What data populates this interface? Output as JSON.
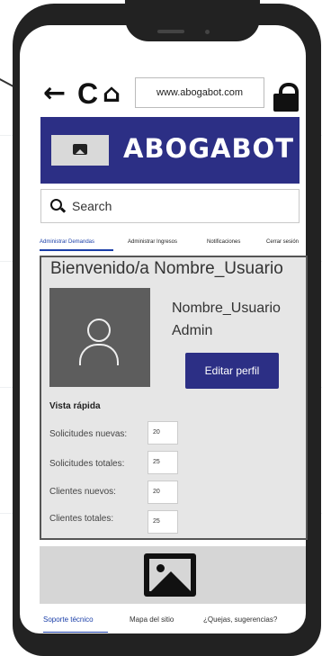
{
  "browser": {
    "back_icon": "←",
    "reload_icon": "C",
    "home_icon": "⌂",
    "url": "www.abogabot.com"
  },
  "banner": {
    "brand": "ABOGABOT",
    "color": "#2c2f85"
  },
  "search": {
    "placeholder": "Search"
  },
  "tabs": [
    {
      "label": "Administrar Demandas"
    },
    {
      "label": "Administrar Ingresos"
    },
    {
      "label": "Notificaciones"
    },
    {
      "label": "Cerrar sesión"
    }
  ],
  "profile": {
    "welcome": "Bienvenido/a Nombre_Usuario",
    "name": "Nombre_Usuario",
    "role": "Admin",
    "edit_label": "Editar perfil"
  },
  "quick_view": {
    "title": "Vista rápida",
    "stats": [
      {
        "label": "Solicitudes nuevas:",
        "value": "20"
      },
      {
        "label": "Solicitudes totales:",
        "value": "25"
      },
      {
        "label": "Clientes nuevos:",
        "value": "20"
      },
      {
        "label": "Clientes totales:",
        "value": "25"
      }
    ]
  },
  "footer": {
    "links": [
      {
        "label": "Soporte técnico"
      },
      {
        "label": "Mapa del sitio"
      },
      {
        "label": "¿Quejas, sugerencias?"
      }
    ]
  },
  "colors": {
    "accent": "#1a3ea8",
    "brand": "#2c2f85"
  }
}
